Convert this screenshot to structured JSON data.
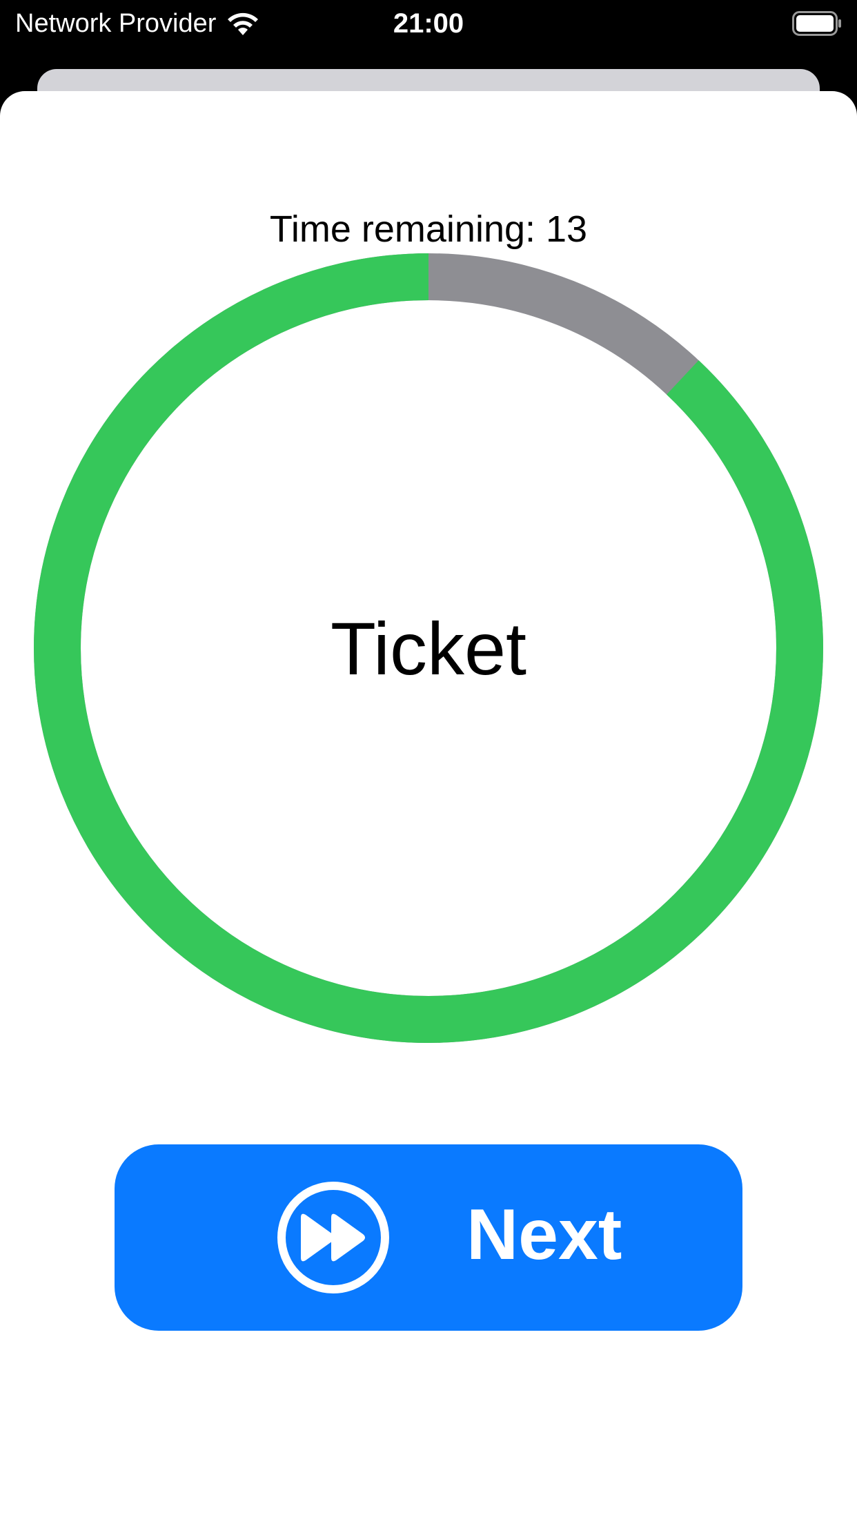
{
  "status_bar": {
    "carrier": "Network Provider",
    "time": "21:00",
    "wifi_icon": "wifi-icon",
    "battery_icon": "battery-icon"
  },
  "timer": {
    "label": "Time remaining: 13",
    "progress_fraction": 0.88,
    "ring_color": "#36c75a",
    "remaining_color": "#8e8e93"
  },
  "ticket": {
    "label": "Ticket"
  },
  "next_button": {
    "label": "Next",
    "icon": "fast-forward-circle-icon",
    "color": "#0a7aff"
  }
}
